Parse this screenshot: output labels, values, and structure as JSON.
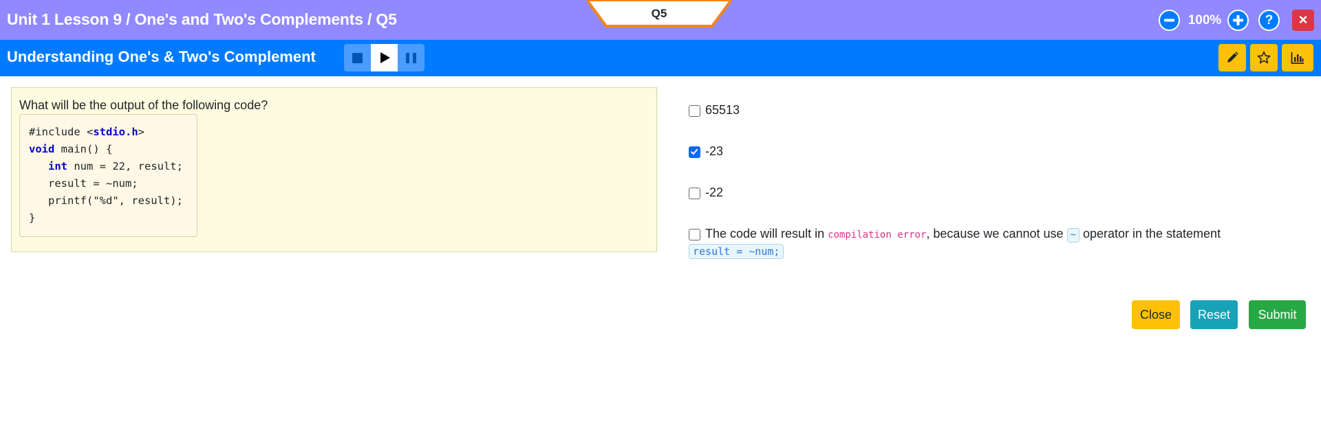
{
  "header": {
    "breadcrumb": "Unit 1 Lesson 9 / One's and Two's Complements / Q5",
    "question_tab": "Q5",
    "zoom_level": "100%",
    "zoom_out_icon": "minus-icon",
    "zoom_in_icon": "plus-icon",
    "help_label": "?",
    "close_label": "×",
    "colors": {
      "bar": "#9189ff",
      "tab_border": "#f0861a",
      "close": "#dc3545"
    }
  },
  "subheader": {
    "title": "Understanding One's & Two's Complement",
    "media_controls": [
      "stop-icon",
      "play-icon",
      "pause-icon"
    ],
    "tools": [
      "pencil-icon",
      "star-icon",
      "bar-chart-icon"
    ],
    "colors": {
      "bar": "#007bff",
      "tools": "#ffc107"
    }
  },
  "question": {
    "prompt": "What will be the output of the following code?",
    "code": {
      "line1_pre": "#include <",
      "line1_kw": "stdio.h",
      "line1_post": ">",
      "line2_kw": "void",
      "line2_post": " main() {",
      "line3_pre": "   ",
      "line3_kw": "int",
      "line3_post": " num = 22, result;",
      "line4": "   result = ~num;",
      "line5": "   printf(\"%d\", result);",
      "line6": "}"
    }
  },
  "options": [
    {
      "label": "65513",
      "checked": false
    },
    {
      "label": "-23",
      "checked": true
    },
    {
      "label": "-22",
      "checked": false
    },
    {
      "text_1": "The code will result in ",
      "code_1": "compilation error",
      "text_2": ", because we cannot use ",
      "code_2": "~",
      "text_3": " operator in the statement",
      "code_3": "result = ~num;",
      "checked": false
    }
  ],
  "actions": {
    "close": "Close",
    "reset": "Reset",
    "submit": "Submit",
    "colors": {
      "close": "#ffc107",
      "reset": "#17a2b8",
      "submit": "#28a745"
    }
  }
}
